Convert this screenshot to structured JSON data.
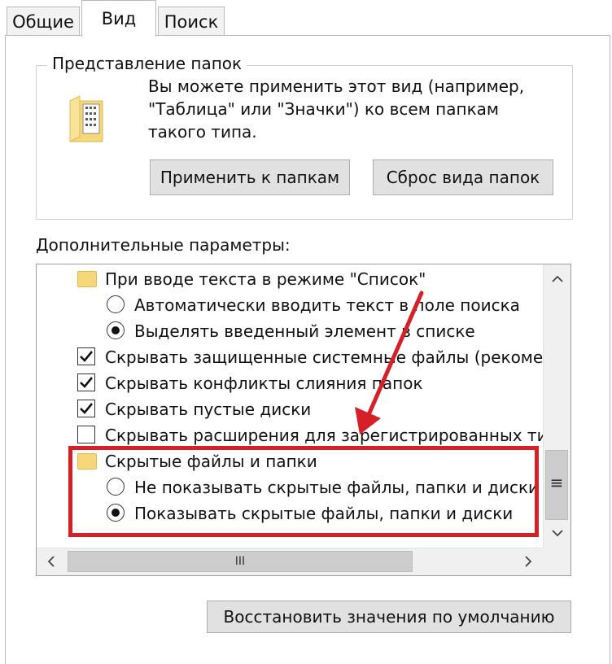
{
  "tabs": [
    {
      "label": "Общие",
      "active": false
    },
    {
      "label": "Вид",
      "active": true
    },
    {
      "label": "Поиск",
      "active": false
    }
  ],
  "folder_views": {
    "title": "Представление папок",
    "description_lines": [
      "Вы можете применить этот вид (например,",
      "\"Таблица\" или \"Значки\") ко всем папкам",
      "такого типа."
    ],
    "apply_button": "Применить к папкам",
    "reset_button": "Сброс вида папок",
    "icon": "folder-view-icon"
  },
  "advanced": {
    "label": "Дополнительные параметры:",
    "items": [
      {
        "type": "folder",
        "text": "При вводе текста в режиме \"Список\""
      },
      {
        "type": "radio",
        "checked": false,
        "text": "Автоматически вводить текст в поле поиска"
      },
      {
        "type": "radio",
        "checked": true,
        "text": "Выделять введенный элемент в списке"
      },
      {
        "type": "checkbox",
        "checked": true,
        "text": "Скрывать защищенные системные файлы (рекомен"
      },
      {
        "type": "checkbox",
        "checked": true,
        "text": "Скрывать конфликты слияния папок"
      },
      {
        "type": "checkbox",
        "checked": true,
        "text": "Скрывать пустые диски"
      },
      {
        "type": "checkbox",
        "checked": false,
        "text": "Скрывать расширения для зарегистрированных типо"
      },
      {
        "type": "folder",
        "text": "Скрытые файлы и папки"
      },
      {
        "type": "radio",
        "checked": false,
        "text": "Не показывать скрытые файлы, папки и диски"
      },
      {
        "type": "radio",
        "checked": true,
        "text": "Показывать скрытые файлы, папки и диски"
      }
    ],
    "scroll_up_icon": "chevron-up-icon",
    "scroll_down_icon": "chevron-down-icon",
    "scroll_left_icon": "chevron-left-icon",
    "scroll_right_icon": "chevron-right-icon",
    "hthumb_grip": "III",
    "vthumb_grip": "≡"
  },
  "restore_button": "Восстановить значения по умолчанию",
  "colors": {
    "highlight": "#d62027",
    "folder": "#f6d77a"
  }
}
